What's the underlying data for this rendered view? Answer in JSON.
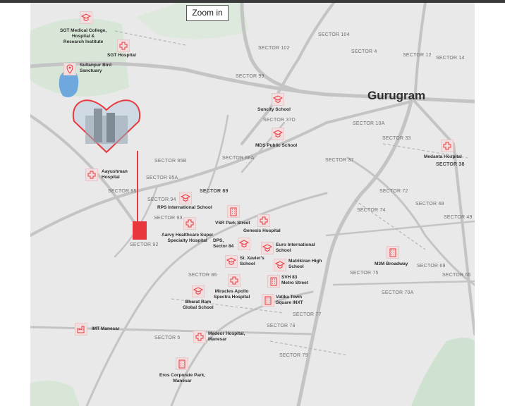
{
  "toolbar": {
    "zoom_label": "Zoom in"
  },
  "map": {
    "city_label": "Gurugram",
    "sectors": {
      "s104": "SECTOR 104",
      "s102": "SECTOR 102",
      "s4": "SECTOR 4",
      "s12": "SECTOR 12",
      "s14": "SECTOR 14",
      "s99": "SECTOR 99",
      "s37d": "SECTOR 37D",
      "s10a": "SECTOR 10A",
      "s33": "SECTOR 33",
      "s38": "SECTOR 38",
      "s95b": "SECTOR 95B",
      "s88a": "SECTOR 88A",
      "s37": "SECTOR 37",
      "s95a": "SECTOR 95A",
      "s95": "SECTOR  95",
      "s89": "SECTOR 89",
      "s72": "SECTOR 72",
      "s94": "SECTOR 94",
      "s74": "SECTOR 74",
      "s48": "SECTOR 48",
      "s93": "SECTOR 93",
      "s49": "SECTOR 49",
      "s92": "SECTOR 92",
      "s69": "SECTOR 69",
      "s75": "SECTOR 75",
      "s66": "SECTOR 66",
      "s86": "SECTOR 86",
      "s70a": "SECTOR 70A",
      "s77": "SECTOR 77",
      "s78": "SECTOR 78",
      "s5": "SECTOR 5",
      "s79": "SECTOR 79"
    },
    "pois": {
      "sgt_college": "SGT Medical College,\nHospital &\nResearch Institute",
      "sgt_hospital": "SGT Hospital",
      "sultanpur": "Sultanpur Bird\nSanctuary",
      "suncity": "Suncity School",
      "mds": "MDS Public School",
      "medanta": "Medanta Hospital",
      "aayushman": "Aayushman\nHospital",
      "rps": "RPS International School",
      "vsr": "VSR Park Street",
      "genesis": "Genesis Hospital",
      "aarvy": "Aarvy Healthcare Super\nSpecialty Hospital",
      "dps": "DPS,\nSector 84",
      "euro": "Euro International\nSchool",
      "stxaviers": "St. Xavier's\nSchool",
      "matrikiran": "Matrikiran High\nSchool",
      "m3m": "M3M Broadway",
      "svh83": "SVH 83\nMetro Street",
      "bharatram": "Bharat Ram\nGlobal School",
      "miracles": "Miracles Apollo\nSpectra Hospital",
      "vatika": "Vatika Town\nSquare INXT",
      "imt": "IMT Manesar",
      "medeor": "Medeor Hospital,\nManesar",
      "eros": "Eros Corporate Park,\nManesar"
    }
  },
  "colors": {
    "accent": "#e8383d",
    "road": "#c9c9c9",
    "map_bg": "#e9e9e9",
    "green": "#d2e4d4",
    "water": "#6fa8dc"
  },
  "icons": {
    "school": "graduation-cap-icon",
    "hospital": "hospital-hand-icon",
    "sanctuary": "location-pin-icon",
    "commercial": "building-icon",
    "industrial": "factory-icon"
  }
}
